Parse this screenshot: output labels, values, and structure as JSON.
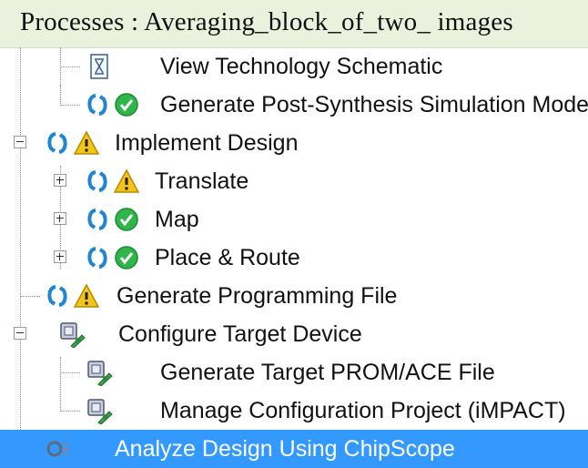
{
  "panel": {
    "title": "Processes : Averaging_block_of_two_ images"
  },
  "tree": {
    "view_schematic": "View Technology Schematic",
    "gen_post_synth": "Generate Post-Synthesis Simulation Model",
    "implement_design": "Implement Design",
    "translate": "Translate",
    "map": "Map",
    "place_route": "Place & Route",
    "gen_prog_file": "Generate Programming File",
    "configure_target": "Configure Target Device",
    "gen_prom": "Generate Target PROM/ACE File",
    "manage_config": "Manage Configuration Project (iMPACT)",
    "analyze_chipscope": "Analyze Design Using ChipScope"
  },
  "icons": {
    "rerun": "rerun-arrows-icon",
    "ok": "green-check-icon",
    "warning": "warning-triangle-icon",
    "schematic": "schematic-icon",
    "device": "device-config-icon",
    "chipscope": "chipscope-icon"
  },
  "colors": {
    "header_bg": "#eaf1dd",
    "selection": "#3399ff",
    "ok": "#2fb54a",
    "warning": "#f4c518",
    "rerun": "#1f86d6"
  }
}
